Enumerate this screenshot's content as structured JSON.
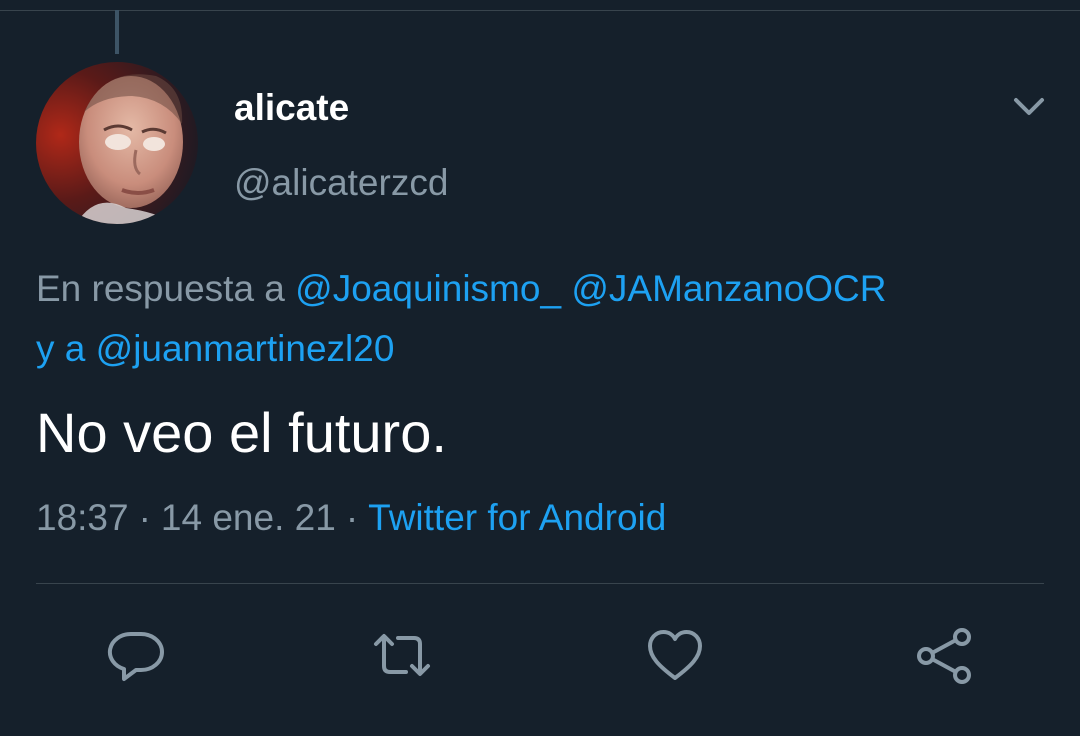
{
  "author": {
    "display_name": "alicate",
    "handle": "@alicaterzcd"
  },
  "reply": {
    "prefix": "En respuesta a",
    "mention_1": "@Joaquinismo_",
    "mention_2": "@JAManzanoOCR",
    "conjunction": "y a",
    "mention_3": "@juanmartinezl20"
  },
  "tweet": {
    "text": "No veo el futuro."
  },
  "meta": {
    "time": "18:37",
    "separator": "·",
    "date": "14 ene. 21",
    "source": "Twitter for Android"
  },
  "icons": {
    "more": "chevron-down-icon",
    "reply": "reply-icon",
    "retweet": "retweet-icon",
    "like": "heart-icon",
    "share": "share-icon"
  },
  "colors": {
    "background": "#15202b",
    "link": "#1da1f2",
    "secondary_text": "#8899a6",
    "divider": "#38444d"
  }
}
